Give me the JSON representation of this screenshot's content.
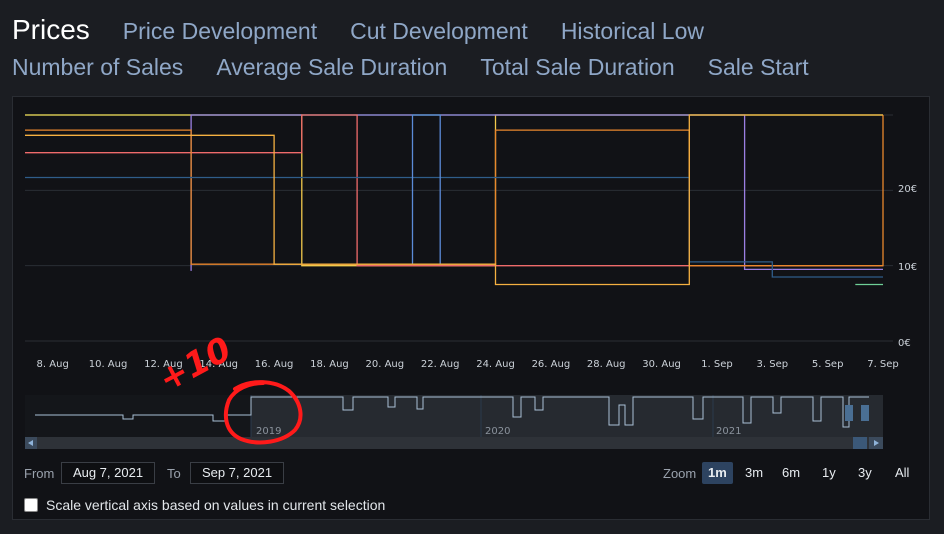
{
  "tabs": {
    "row1": [
      "Prices",
      "Price Development",
      "Cut Development",
      "Historical Low"
    ],
    "row2": [
      "Number of Sales",
      "Average Sale Duration",
      "Total Sale Duration",
      "Sale Start"
    ]
  },
  "chart_data": {
    "type": "line",
    "step": true,
    "title": "",
    "xlabel": "",
    "ylabel": "",
    "x_range": [
      "2021-08-07",
      "2021-09-07"
    ],
    "x_ticks": [
      "8. Aug",
      "10. Aug",
      "12. Aug",
      "14. Aug",
      "16. Aug",
      "18. Aug",
      "20. Aug",
      "22. Aug",
      "24. Aug",
      "26. Aug",
      "28. Aug",
      "30. Aug",
      "1. Sep",
      "3. Sep",
      "5. Sep",
      "7. Sep"
    ],
    "y_ticks": [
      "0€",
      "10€",
      "20€"
    ],
    "ylim": [
      0,
      30
    ],
    "grid": true,
    "series": [
      {
        "color": "#4ade80",
        "points": [
          [
            "2021-08-07",
            30
          ],
          [
            "2021-09-08",
            30
          ]
        ]
      },
      {
        "color": "#f2c94c",
        "points": [
          [
            "2021-08-07",
            30
          ],
          [
            "2021-08-17",
            30
          ],
          [
            "2021-08-17",
            10
          ],
          [
            "2021-08-24",
            10
          ],
          [
            "2021-08-24",
            30
          ],
          [
            "2021-09-08",
            30
          ]
        ]
      },
      {
        "color": "#9b7fe3",
        "points": [
          [
            "2021-08-13",
            9.3
          ],
          [
            "2021-08-13",
            30
          ],
          [
            "2021-09-02",
            30
          ],
          [
            "2021-09-02",
            9.5
          ],
          [
            "2021-09-08",
            9.5
          ]
        ]
      },
      {
        "color": "#ef6b6b",
        "points": [
          [
            "2021-08-07",
            25
          ],
          [
            "2021-08-17",
            25
          ],
          [
            "2021-08-17",
            30
          ],
          [
            "2021-08-19",
            30
          ],
          [
            "2021-08-19",
            10
          ],
          [
            "2021-09-08",
            10
          ]
        ]
      },
      {
        "color": "#e9872d",
        "points": [
          [
            "2021-08-07",
            28
          ],
          [
            "2021-08-13",
            28
          ],
          [
            "2021-08-13",
            10.2
          ],
          [
            "2021-08-24",
            10.2
          ],
          [
            "2021-08-24",
            28
          ],
          [
            "2021-08-31",
            28
          ],
          [
            "2021-08-31",
            10
          ],
          [
            "2021-09-07",
            10
          ],
          [
            "2021-09-07",
            30
          ]
        ]
      },
      {
        "color": "#2f5d8a",
        "points": [
          [
            "2021-08-07",
            21.7
          ],
          [
            "2021-08-31",
            21.7
          ],
          [
            "2021-08-31",
            10.5
          ],
          [
            "2021-09-03",
            10.5
          ],
          [
            "2021-09-03",
            8.5
          ],
          [
            "2021-09-08",
            8.5
          ]
        ]
      },
      {
        "color": "#5b8bd8",
        "points": [
          [
            "2021-08-21",
            10.2
          ],
          [
            "2021-08-21",
            30
          ],
          [
            "2021-08-22",
            30
          ],
          [
            "2021-08-22",
            10.2
          ]
        ]
      },
      {
        "color": "#f5b041",
        "points": [
          [
            "2021-08-07",
            27.3
          ],
          [
            "2021-08-16",
            27.3
          ],
          [
            "2021-08-16",
            10.2
          ],
          [
            "2021-08-24",
            10.2
          ],
          [
            "2021-08-24",
            7.5
          ],
          [
            "2021-08-31",
            7.5
          ],
          [
            "2021-08-31",
            30
          ],
          [
            "2021-09-08",
            30
          ]
        ]
      },
      {
        "color": "#6fcf97",
        "points": [
          [
            "2021-09-06",
            7.5
          ],
          [
            "2021-09-08",
            7.5
          ]
        ]
      }
    ],
    "navigator": {
      "year_labels": [
        "2019",
        "2020",
        "2021"
      ]
    }
  },
  "annotation": {
    "text": "+10"
  },
  "range": {
    "from_label": "From",
    "from_value": "Aug 7, 2021",
    "to_label": "To",
    "to_value": "Sep 7, 2021"
  },
  "zoom": {
    "label": "Zoom",
    "buttons": [
      "1m",
      "3m",
      "6m",
      "1y",
      "3y",
      "All"
    ],
    "active": "1m"
  },
  "scale_option": {
    "label": "Scale vertical axis based on values in current selection",
    "checked": false
  }
}
